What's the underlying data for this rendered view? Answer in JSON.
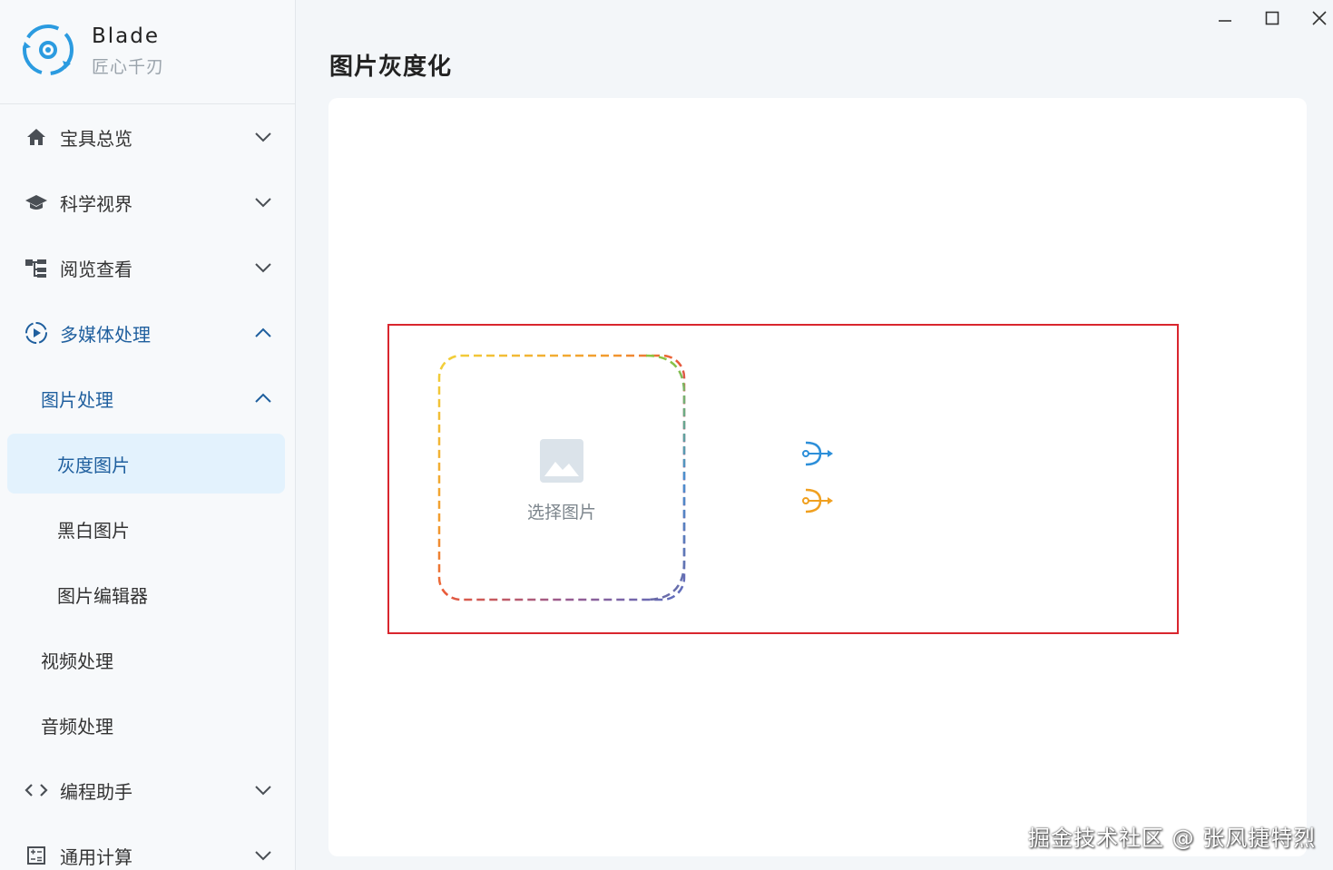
{
  "brand": {
    "name": "Blade",
    "subtitle": "匠心千刃"
  },
  "window": {
    "minimize": "minimize-icon",
    "maximize": "maximize-icon",
    "close": "close-icon"
  },
  "sidebar": {
    "items": [
      {
        "label": "宝具总览",
        "icon": "home-icon"
      },
      {
        "label": "科学视界",
        "icon": "graduation-cap-icon"
      },
      {
        "label": "阅览查看",
        "icon": "tree-structure-icon"
      },
      {
        "label": "多媒体处理",
        "icon": "play-circle-icon"
      },
      {
        "label": "图片处理"
      },
      {
        "label": "灰度图片"
      },
      {
        "label": "黑白图片"
      },
      {
        "label": "图片编辑器"
      },
      {
        "label": "视频处理"
      },
      {
        "label": "音频处理"
      },
      {
        "label": "编程助手",
        "icon": "code-icon"
      },
      {
        "label": "通用计算",
        "icon": "calculator-icon"
      }
    ]
  },
  "main": {
    "title": "图片灰度化",
    "picker_label": "选择图片"
  },
  "colors": {
    "accent": "#1f5f9e",
    "selected_bg": "#e3f2fd",
    "highlight": "#d9262e",
    "arrow_blue": "#2d8fd9",
    "arrow_orange": "#f0a020"
  },
  "watermark": "掘金技术社区 @ 张风捷特烈"
}
